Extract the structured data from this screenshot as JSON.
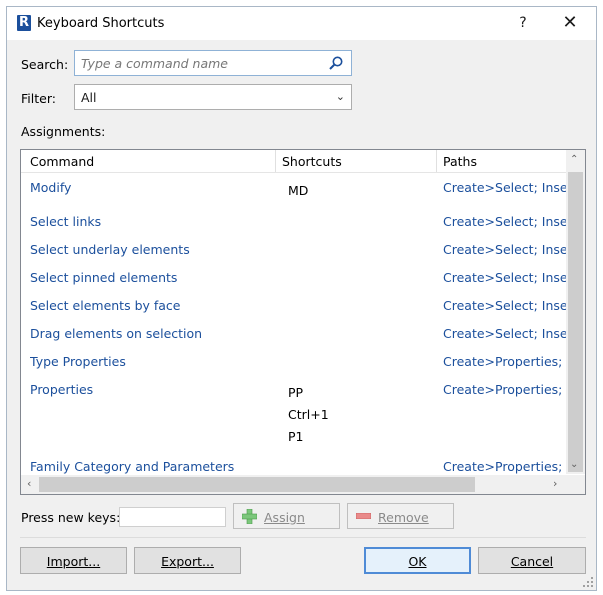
{
  "window": {
    "title": "Keyboard Shortcuts",
    "help_label": "?",
    "close_label": "✕",
    "app_icon_letter": "R"
  },
  "search": {
    "label": "Search:",
    "placeholder": "Type a command name",
    "value": ""
  },
  "filter": {
    "label": "Filter:",
    "value": "All"
  },
  "assignments": {
    "label": "Assignments:",
    "columns": [
      "Command",
      "Shortcuts",
      "Paths"
    ],
    "rows": [
      {
        "command": "Modify",
        "shortcuts": [
          "MD"
        ],
        "paths": "Create>Select; Insert>"
      },
      {
        "command": "Select links",
        "shortcuts": [],
        "paths": "Create>Select; Insert>"
      },
      {
        "command": "Select underlay elements",
        "shortcuts": [],
        "paths": "Create>Select; Insert>"
      },
      {
        "command": "Select pinned elements",
        "shortcuts": [],
        "paths": "Create>Select; Insert>"
      },
      {
        "command": "Select elements by face",
        "shortcuts": [],
        "paths": "Create>Select; Insert>"
      },
      {
        "command": "Drag elements on selection",
        "shortcuts": [],
        "paths": "Create>Select; Insert>"
      },
      {
        "command": "Type Properties",
        "shortcuts": [],
        "paths": "Create>Properties; Mo"
      },
      {
        "command": "Properties",
        "shortcuts": [
          "PP",
          "Ctrl+1",
          "P1"
        ],
        "paths": "Create>Properties; Vie"
      },
      {
        "command": "Family Category and Parameters",
        "shortcuts": [],
        "paths": "Create>Properties; Mo"
      }
    ]
  },
  "press_keys": {
    "label": "Press new keys:",
    "value": ""
  },
  "buttons": {
    "assign": "Assign",
    "remove": "Remove",
    "import": "Import...",
    "export": "Export...",
    "ok": "OK",
    "cancel": "Cancel"
  },
  "colors": {
    "link": "#1b4f9c",
    "assign_icon": "#5cb85c",
    "remove_icon": "#e06666",
    "focus_border": "#4f8bd6"
  }
}
